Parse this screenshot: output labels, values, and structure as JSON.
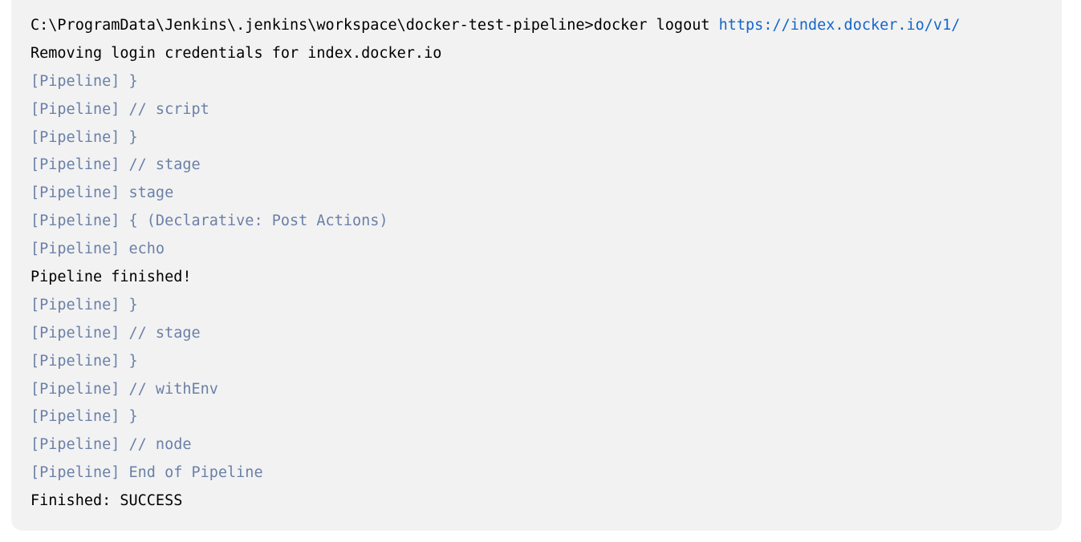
{
  "colors": {
    "text": "#000000",
    "pipeline": "#6a80a8",
    "link": "#1466c8",
    "background": "#f2f2f2"
  },
  "console": {
    "lines": [
      {
        "type": "command",
        "text": "C:\\ProgramData\\Jenkins\\.jenkins\\workspace\\docker-test-pipeline>docker logout ",
        "link": "https://index.docker.io/v1/"
      },
      {
        "type": "output",
        "text": "Removing login credentials for index.docker.io"
      },
      {
        "type": "pipeline",
        "text": "[Pipeline] }"
      },
      {
        "type": "pipeline",
        "text": "[Pipeline] // script"
      },
      {
        "type": "pipeline",
        "text": "[Pipeline] }"
      },
      {
        "type": "pipeline",
        "text": "[Pipeline] // stage"
      },
      {
        "type": "pipeline",
        "text": "[Pipeline] stage"
      },
      {
        "type": "pipeline",
        "text": "[Pipeline] { (Declarative: Post Actions)"
      },
      {
        "type": "pipeline",
        "text": "[Pipeline] echo"
      },
      {
        "type": "output",
        "text": "Pipeline finished!"
      },
      {
        "type": "pipeline",
        "text": "[Pipeline] }"
      },
      {
        "type": "pipeline",
        "text": "[Pipeline] // stage"
      },
      {
        "type": "pipeline",
        "text": "[Pipeline] }"
      },
      {
        "type": "pipeline",
        "text": "[Pipeline] // withEnv"
      },
      {
        "type": "pipeline",
        "text": "[Pipeline] }"
      },
      {
        "type": "pipeline",
        "text": "[Pipeline] // node"
      },
      {
        "type": "pipeline",
        "text": "[Pipeline] End of Pipeline"
      },
      {
        "type": "output",
        "text": "Finished: SUCCESS"
      }
    ]
  }
}
